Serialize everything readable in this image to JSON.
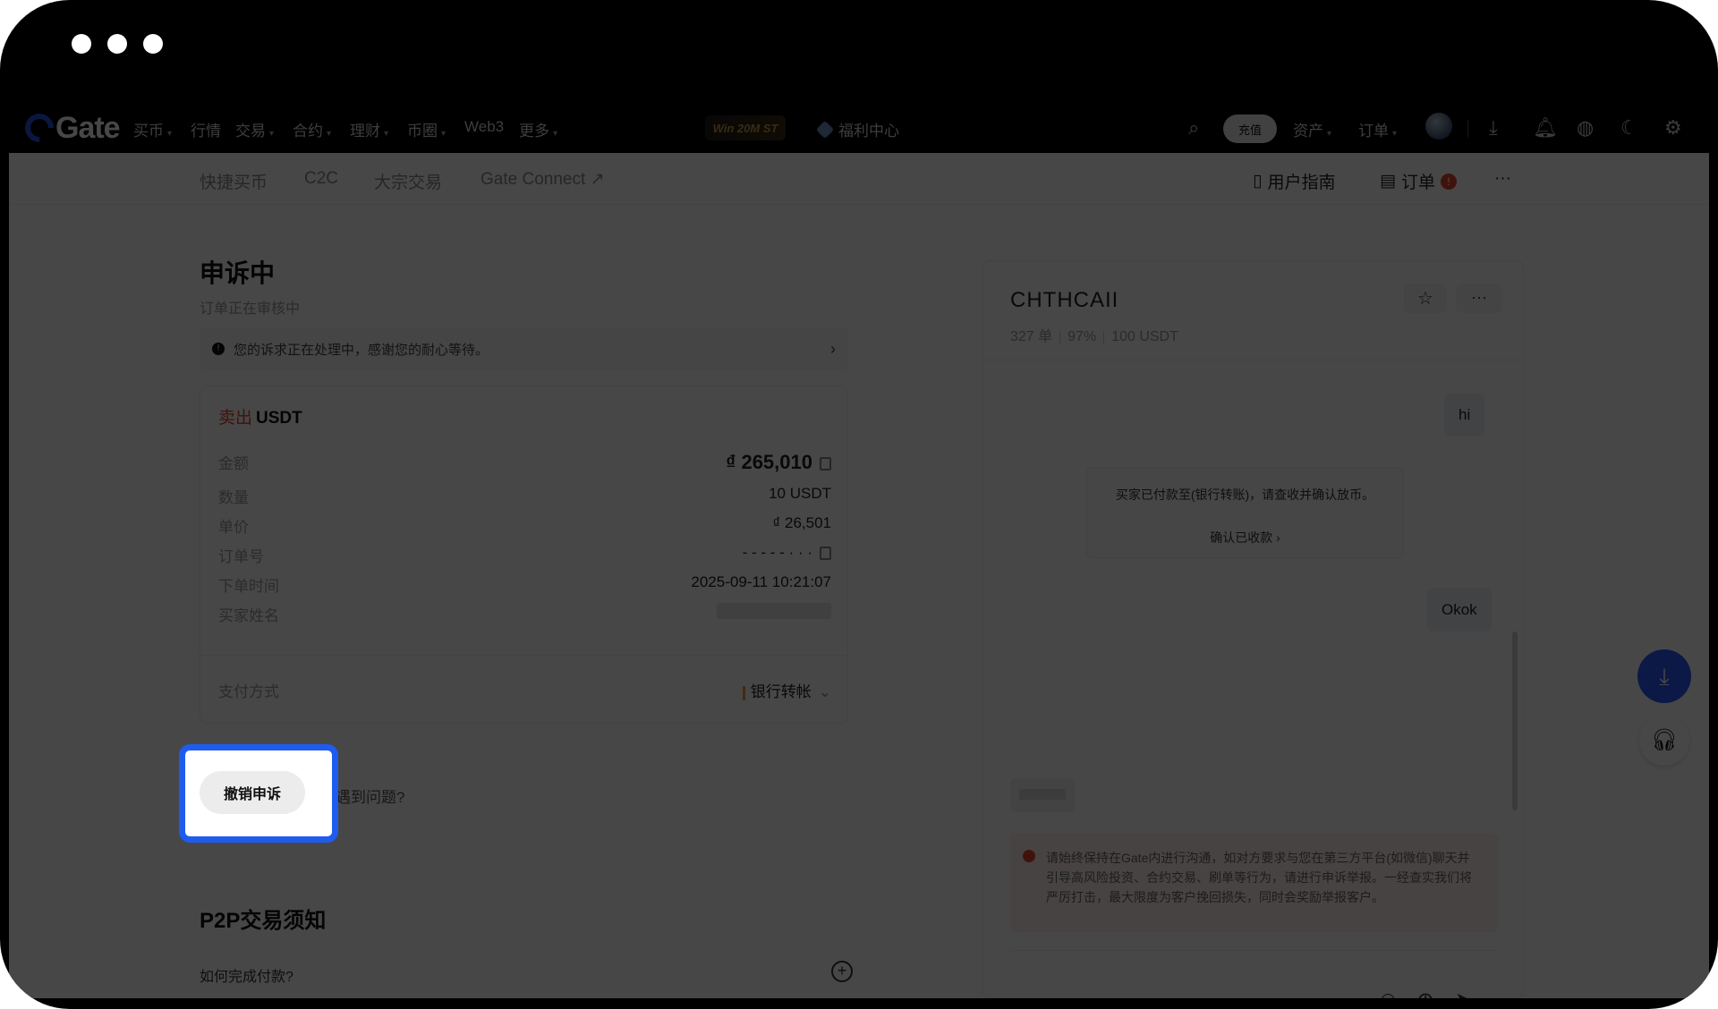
{
  "nav": {
    "logo": "Gate",
    "items": [
      {
        "label": "买币",
        "caret": true
      },
      {
        "label": "行情",
        "caret": false
      },
      {
        "label": "交易",
        "caret": true
      },
      {
        "label": "合约",
        "caret": true
      },
      {
        "label": "理财",
        "caret": true
      },
      {
        "label": "币圈",
        "caret": true
      },
      {
        "label": "Web3",
        "caret": false
      },
      {
        "label": "更多",
        "caret": true
      }
    ],
    "promo": "Win 20M ST",
    "hub": "福利中心",
    "deposit": "充值",
    "assets": "资产",
    "orders": "订单"
  },
  "subnav": {
    "items": [
      "快捷买币",
      "C2C",
      "大宗交易",
      "Gate Connect ↗"
    ],
    "guide": "用户指南",
    "orders": "订单",
    "orders_badge": "!",
    "more": "···"
  },
  "status": {
    "title": "申诉中",
    "subtitle": "订单正在审核中",
    "notice": "您的诉求正在处理中，感谢您的耐心等待。"
  },
  "order": {
    "side": "卖出",
    "asset": "USDT",
    "rows": [
      {
        "label": "金额",
        "value": "₫ 265,010"
      },
      {
        "label": "数量",
        "value": "10 USDT"
      },
      {
        "label": "单价",
        "value": "₫ 26,501"
      },
      {
        "label": "订单号",
        "value": "- - - - - · · ·"
      },
      {
        "label": "下单时间",
        "value": "2025-09-11 10:21:07"
      },
      {
        "label": "买家姓名",
        "value": ""
      }
    ],
    "payment_label": "支付方式",
    "payment_value": "银行转帐"
  },
  "actions": {
    "cancel_appeal": "撤销申诉",
    "problem": "遇到问题?"
  },
  "p2p": {
    "title": "P2P交易须知",
    "faq": "如何完成付款?"
  },
  "chat": {
    "name": "CHTHCAII",
    "stats": [
      "327 单",
      "97%",
      "100 USDT"
    ],
    "messages": {
      "hi": "hi",
      "system": "买家已付款至(银行转账)，请查收并确认放币。",
      "confirm": "确认已收款 ›",
      "okok": "Okok"
    },
    "warning": "请始终保持在Gate内进行沟通，如对方要求与您在第三方平台(如微信)聊天并引导高风险投资、合约交易、刷单等行为，请进行申诉举报。一经查实我们将严厉打击，最大限度为客户挽回损失，同时会奖励举报客户。"
  },
  "colors": {
    "accent": "#1e5cf0",
    "sell": "#e0442b",
    "fab": "#2d5bff"
  }
}
